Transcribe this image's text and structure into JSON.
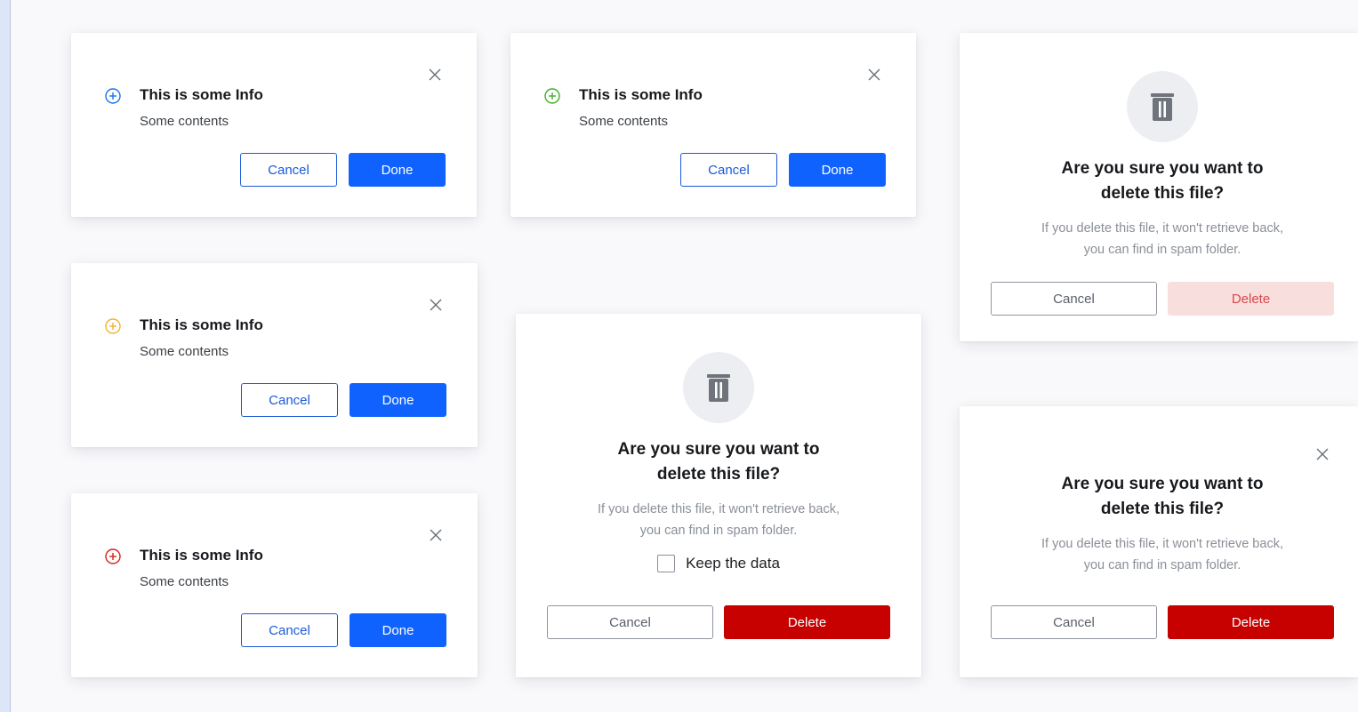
{
  "info_dialogs": [
    {
      "variant": "info",
      "icon": "plus-circle-icon",
      "icon_color": "#1a73e8",
      "title": "This is some Info",
      "content": "Some contents",
      "cancel_label": "Cancel",
      "done_label": "Done"
    },
    {
      "variant": "success",
      "icon": "plus-circle-icon",
      "icon_color": "#3fae2a",
      "title": "This is some Info",
      "content": "Some contents",
      "cancel_label": "Cancel",
      "done_label": "Done"
    },
    {
      "variant": "warning",
      "icon": "plus-circle-icon",
      "icon_color": "#f2b134",
      "title": "This is some Info",
      "content": "Some contents",
      "cancel_label": "Cancel",
      "done_label": "Done"
    },
    {
      "variant": "error",
      "icon": "plus-circle-icon",
      "icon_color": "#d9221c",
      "title": "This is some Info",
      "content": "Some contents",
      "cancel_label": "Cancel",
      "done_label": "Done"
    }
  ],
  "delete_dialog_checkbox": {
    "icon": "trash-icon",
    "title_line1": "Are you sure you want to",
    "title_line2": "delete this file?",
    "desc_line1": "If you delete this file, it won't retrieve back,",
    "desc_line2": "you can find in spam folder.",
    "checkbox_label": "Keep the data",
    "checkbox_checked": false,
    "cancel_label": "Cancel",
    "delete_label": "Delete"
  },
  "delete_dialog_disabled": {
    "icon": "trash-icon",
    "title_line1": "Are you sure you want to",
    "title_line2": "delete this file?",
    "desc_line1": "If you delete this file, it won't retrieve back,",
    "desc_line2": "you can find in spam folder.",
    "cancel_label": "Cancel",
    "delete_label": "Delete",
    "delete_state": "disabled"
  },
  "delete_dialog_close": {
    "title_line1": "Are you sure you want to",
    "title_line2": "delete this file?",
    "desc_line1": "If you delete this file, it won't retrieve back,",
    "desc_line2": "you can find in spam folder.",
    "cancel_label": "Cancel",
    "delete_label": "Delete"
  },
  "colors": {
    "primary": "#0f62fe",
    "danger": "#c70000",
    "danger_disabled_bg": "#f9dede",
    "icon_bg": "#eceef1"
  }
}
